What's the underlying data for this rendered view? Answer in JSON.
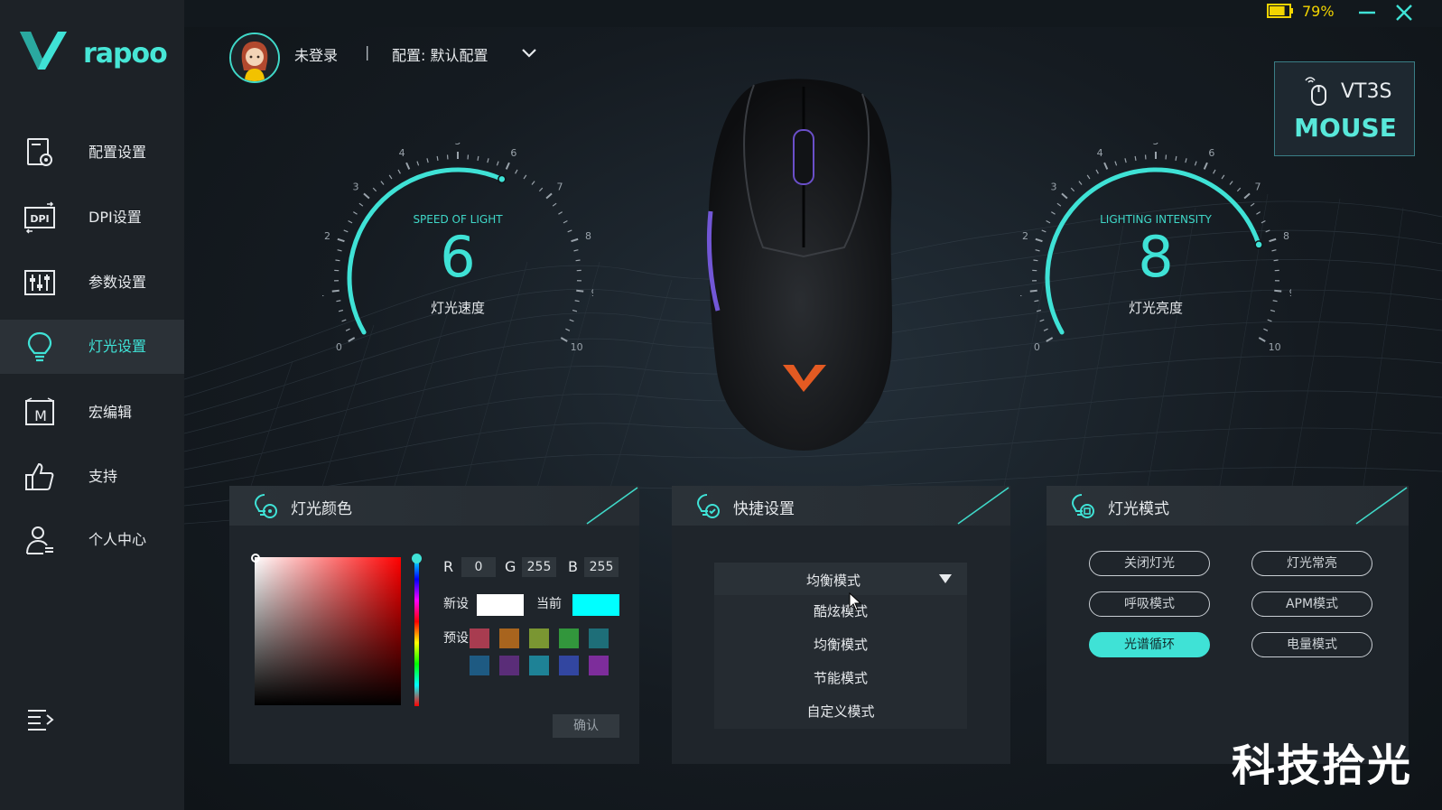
{
  "brand": {
    "logo_text": "rapoo"
  },
  "status": {
    "battery_percent": "79%",
    "battery_level": 0.79
  },
  "header": {
    "user": "未登录",
    "separator": "|",
    "profile": "配置: 默认配置"
  },
  "sidebar": {
    "items": [
      {
        "label": "配置设置",
        "icon": "config-icon"
      },
      {
        "label": "DPI设置",
        "icon": "dpi-icon"
      },
      {
        "label": "参数设置",
        "icon": "sliders-icon"
      },
      {
        "label": "灯光设置",
        "icon": "bulb-icon",
        "active": true
      },
      {
        "label": "宏编辑",
        "icon": "macro-icon"
      },
      {
        "label": "支持",
        "icon": "thumbs-up-icon"
      },
      {
        "label": "个人中心",
        "icon": "user-icon"
      }
    ]
  },
  "device": {
    "model": "VT3S",
    "kind": "MOUSE"
  },
  "gauges": {
    "speed": {
      "caption": "SPEED OF LIGHT",
      "value": "6",
      "label": "灯光速度",
      "ticks": [
        "0",
        "1",
        "2",
        "3",
        "4",
        "5",
        "6",
        "7",
        "8",
        "9",
        "10"
      ]
    },
    "intensity": {
      "caption": "LIGHTING INTENSITY",
      "value": "8",
      "label": "灯光亮度",
      "ticks": [
        "0",
        "1",
        "2",
        "3",
        "4",
        "5",
        "6",
        "7",
        "8",
        "9",
        "10"
      ]
    }
  },
  "color_panel": {
    "title": "灯光颜色",
    "r_label": "R",
    "r": "0",
    "g_label": "G",
    "g": "255",
    "b_label": "B",
    "b": "255",
    "new_label": "新设",
    "current_label": "当前",
    "preset_label": "预设",
    "new_color": "#ffffff",
    "current_color": "#00ffff",
    "presets": [
      "#a83c50",
      "#a8641e",
      "#7a9632",
      "#32963c",
      "#1e6e78",
      "#1e5a82",
      "#5a2d78",
      "#1e8296",
      "#3246a0",
      "#7d2d9b"
    ],
    "confirm": "确认"
  },
  "quick_panel": {
    "title": "快捷设置",
    "selected": "均衡模式",
    "options": [
      "酷炫模式",
      "均衡模式",
      "节能模式",
      "自定义模式"
    ]
  },
  "mode_panel": {
    "title": "灯光模式",
    "buttons": [
      {
        "label": "关闭灯光"
      },
      {
        "label": "灯光常亮"
      },
      {
        "label": "呼吸模式"
      },
      {
        "label": "APM模式"
      },
      {
        "label": "光谱循环",
        "active": true
      },
      {
        "label": "电量模式"
      }
    ]
  },
  "watermark": "科技拾光",
  "colors": {
    "accent": "#3fe2d6",
    "sidebar": "#1d2227",
    "panel": "#1f252b"
  }
}
